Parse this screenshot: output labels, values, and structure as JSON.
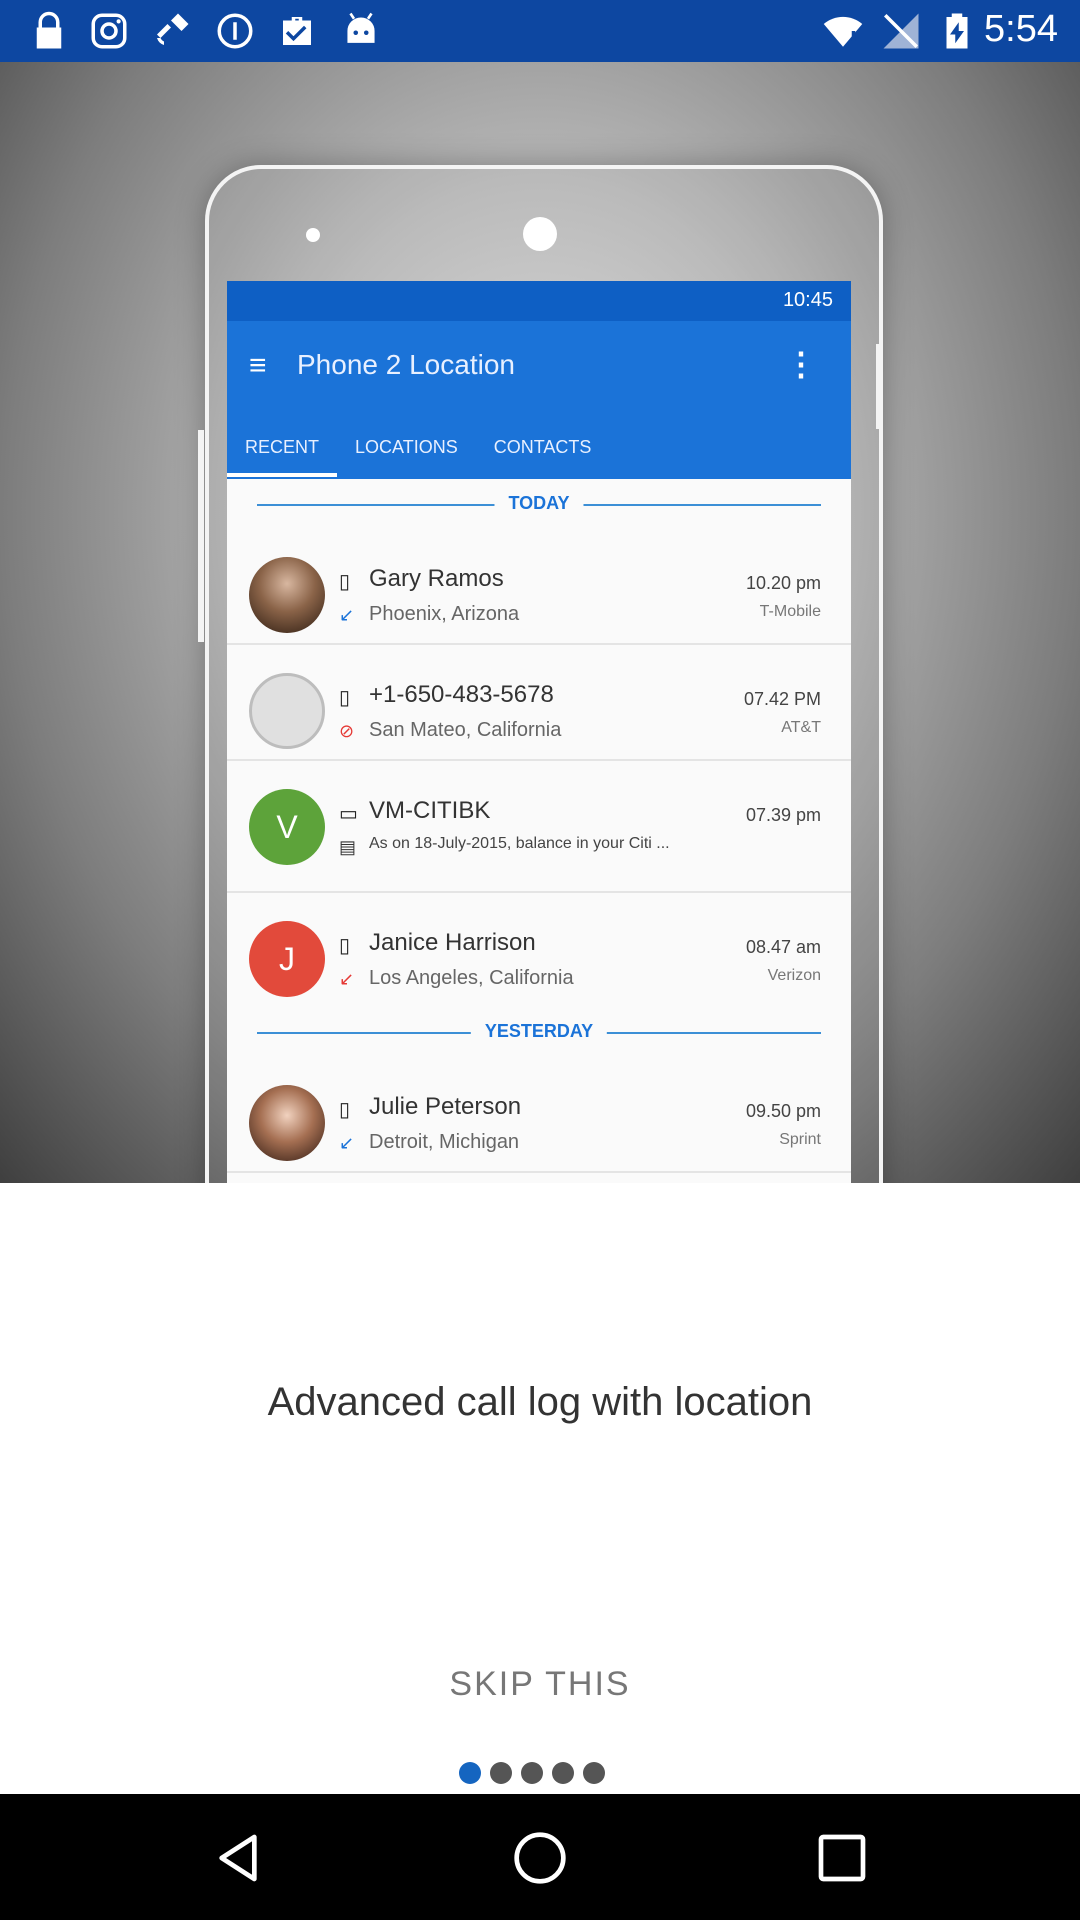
{
  "status_bar": {
    "time": "5:54",
    "icons": [
      "lock-icon",
      "instagram-icon",
      "fake-gps-icon",
      "info-circle-icon",
      "briefcase-check-icon",
      "android-icon",
      "wifi-alert-icon",
      "signal-off-icon",
      "battery-charging-icon"
    ]
  },
  "hero": {
    "app_status_time": "10:45",
    "app_title": "Phone 2 Location",
    "tabs": [
      "RECENT",
      "LOCATIONS",
      "CONTACTS"
    ],
    "sections": {
      "today": "TODAY",
      "yesterday": "YESTERDAY"
    },
    "calls": [
      {
        "name": "Gary Ramos",
        "location": "Phoenix, Arizona",
        "time": "10.20 pm",
        "carrier": "T-Mobile"
      },
      {
        "name": "+1-650-483-5678",
        "location": "San Mateo, California",
        "time": "07.42 PM",
        "carrier": "AT&T"
      },
      {
        "avatar_letter": "V",
        "name": "VM-CITIBK",
        "location": "As on 18-July-2015, balance in your Citi ...",
        "time": "07.39 pm",
        "carrier": ""
      },
      {
        "avatar_letter": "J",
        "name": "Janice Harrison",
        "location": "Los Angeles, California",
        "time": "08.47 am",
        "carrier": "Verizon"
      },
      {
        "name": "Julie Peterson",
        "location": "Detroit, Michigan",
        "time": "09.50 pm",
        "carrier": "Sprint"
      }
    ]
  },
  "onboarding": {
    "caption": "Advanced call log with location",
    "skip_label": "SKIP THIS",
    "page_count": 5,
    "current_page": 1
  },
  "colors": {
    "status_bar": "#0d47a1",
    "app_primary": "#1b73d8",
    "dot_active": "#1565c0",
    "dot_inactive": "#555555"
  }
}
